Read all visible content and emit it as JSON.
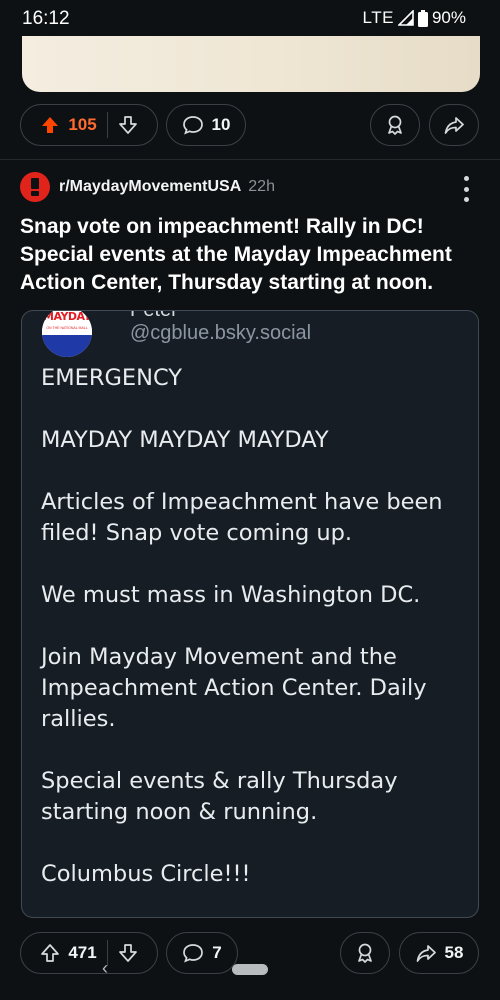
{
  "status": {
    "time": "16:12",
    "network": "LTE",
    "battery": "90%"
  },
  "prev_post": {
    "upvotes": "105",
    "comments": "10",
    "vote_color": "#ff4500"
  },
  "post": {
    "community": "r/MaydayMovementUSA",
    "age": "22h",
    "title": "Snap vote on impeachment! Rally in DC! Special events at the Mayday Impeachment Action Center, Thursday starting at noon.",
    "embed": {
      "display_name": "Peter",
      "handle": "@cgblue.bsky.social",
      "avatar_logo": "MAYDAY",
      "avatar_logo_sub": "ON THE NATIONAL MALL",
      "paragraphs": [
        "EMERGENCY",
        "MAYDAY MAYDAY MAYDAY",
        "Articles of Impeachment have been filed! Snap vote coming up.",
        "We must mass in Washington DC.",
        "Join Mayday Movement and the Impeachment Action Center. Daily rallies.",
        "Special events & rally Thursday starting noon & running.",
        "Columbus Circle!!!"
      ]
    },
    "upvotes": "471",
    "comments": "7",
    "shares": "58"
  },
  "icons": {
    "upvote": "arrow-up-icon",
    "downvote": "arrow-down-icon",
    "comment": "comment-bubble-icon",
    "award": "award-icon",
    "share": "share-arrow-icon",
    "overflow": "more-vertical-icon",
    "community": "community-avatar-icon"
  },
  "colors": {
    "background": "#0e1113",
    "accent_orange": "#ff4500",
    "community_red": "#e0241c",
    "embed_bg": "#171d25",
    "embed_border": "#3f4a55",
    "link_blue": "#3e6fd8"
  }
}
